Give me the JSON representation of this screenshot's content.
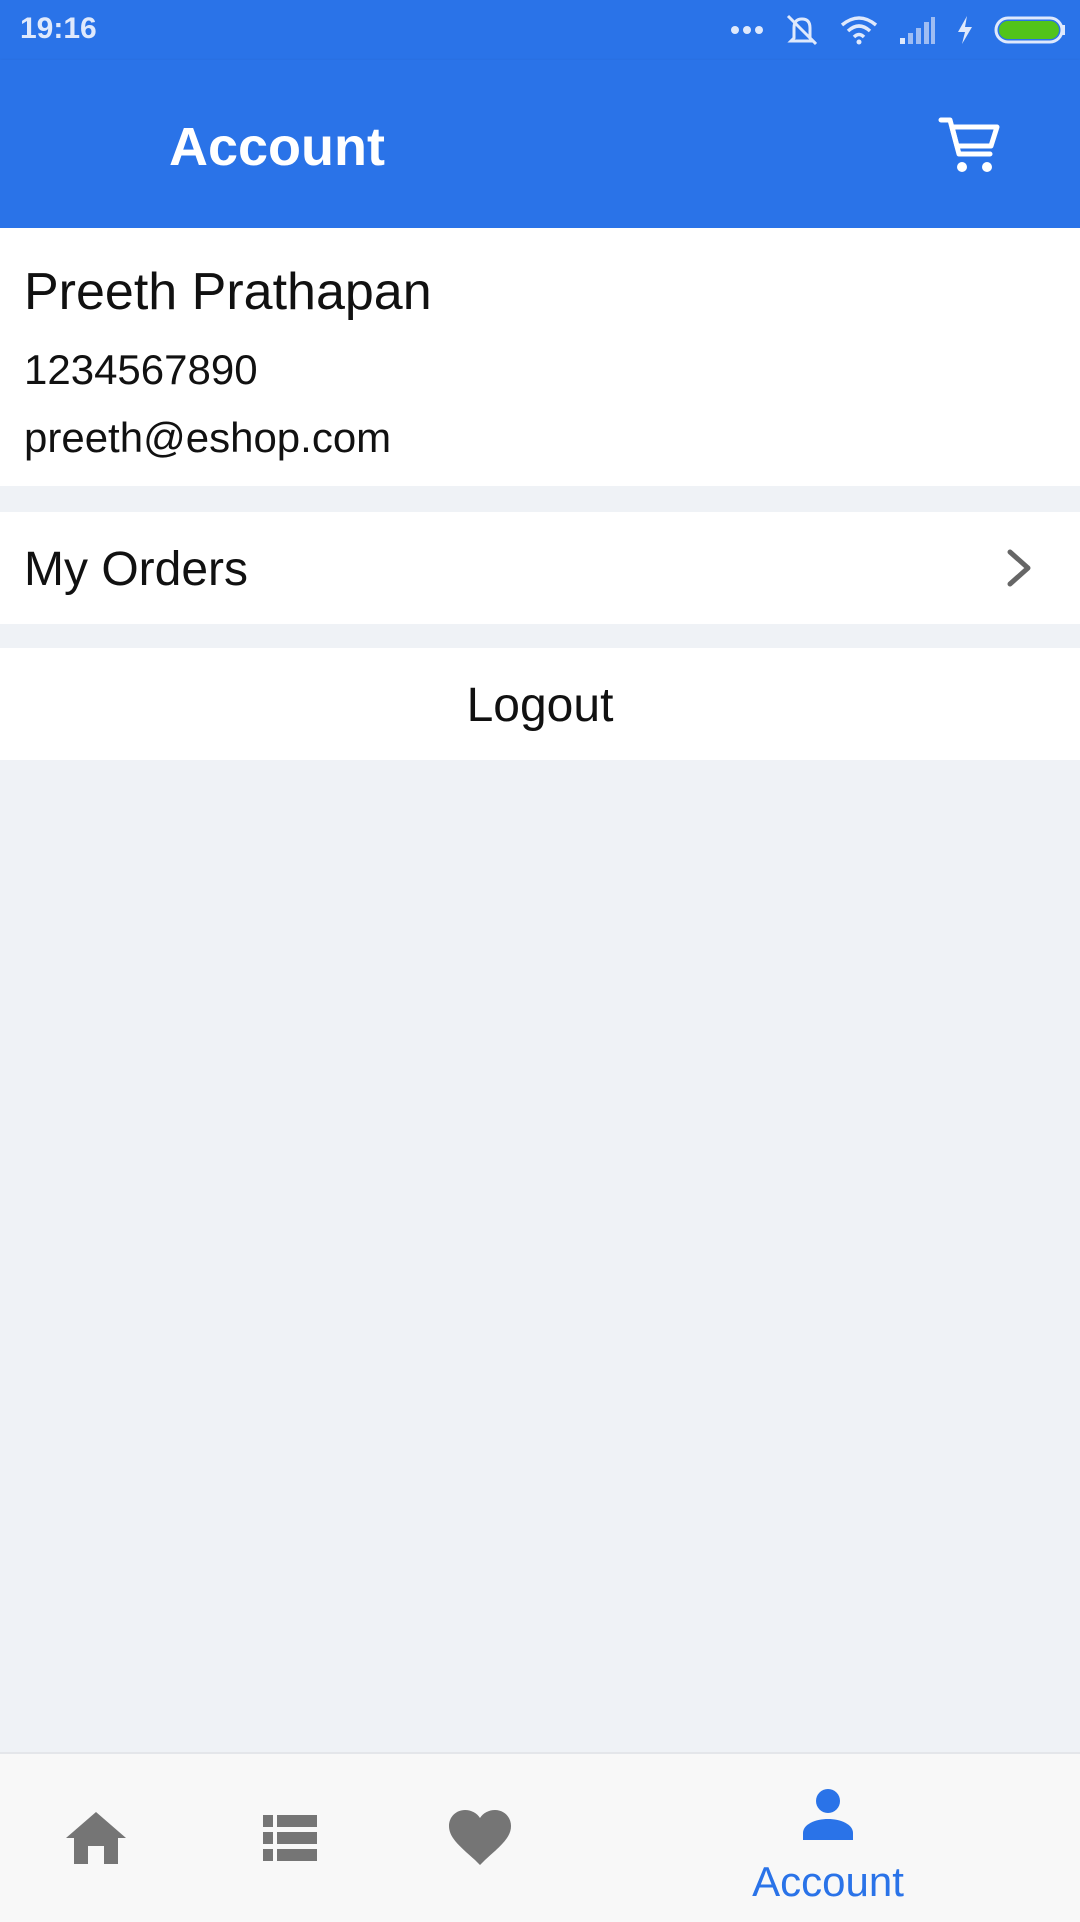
{
  "status_bar": {
    "time": "19:16",
    "icons": [
      "more-dots-icon",
      "alarm-off-icon",
      "wifi-icon",
      "signal-icon",
      "charging-icon",
      "battery-icon"
    ]
  },
  "app_bar": {
    "title": "Account",
    "cart_icon": "cart-icon",
    "color": "#2a73e8"
  },
  "profile": {
    "name": "Preeth Prathapan",
    "phone": "1234567890",
    "email": "preeth@eshop.com"
  },
  "menu": {
    "orders_label": "My Orders",
    "logout_label": "Logout"
  },
  "bottom_nav": {
    "items": [
      {
        "icon": "home-icon",
        "label": ""
      },
      {
        "icon": "list-icon",
        "label": ""
      },
      {
        "icon": "heart-icon",
        "label": ""
      },
      {
        "icon": "person-icon",
        "label": "Account",
        "active": true
      }
    ],
    "active_color": "#2a73e8",
    "inactive_color": "#757575"
  }
}
